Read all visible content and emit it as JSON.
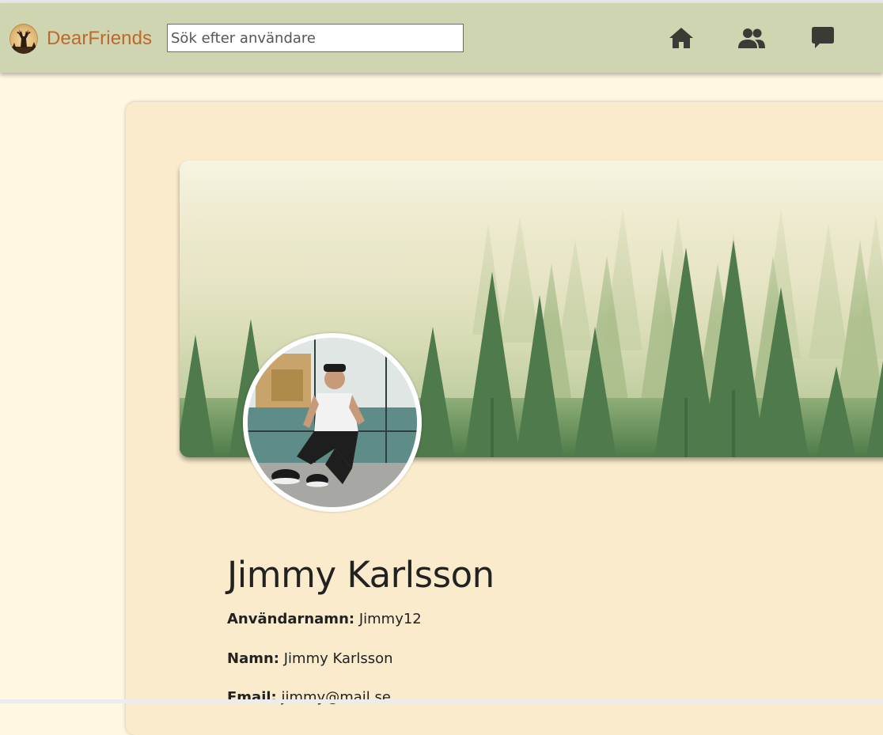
{
  "header": {
    "brand_name": "DearFriends",
    "search_placeholder": "Sök efter användare",
    "icons": [
      "home-icon",
      "people-icon",
      "chat-icon"
    ]
  },
  "profile": {
    "name": "Jimmy Karlsson",
    "fields": [
      {
        "label": "Användarnamn:",
        "value": "Jimmy12"
      },
      {
        "label": "Namn:",
        "value": "Jimmy Karlsson"
      },
      {
        "label": "Email:",
        "value": "jimmy@mail.se"
      }
    ]
  },
  "colors": {
    "navbar": "#cfd5b1",
    "brand": "#c0672a",
    "page_background": "#fef8e2",
    "card": "#f9ebcb"
  }
}
